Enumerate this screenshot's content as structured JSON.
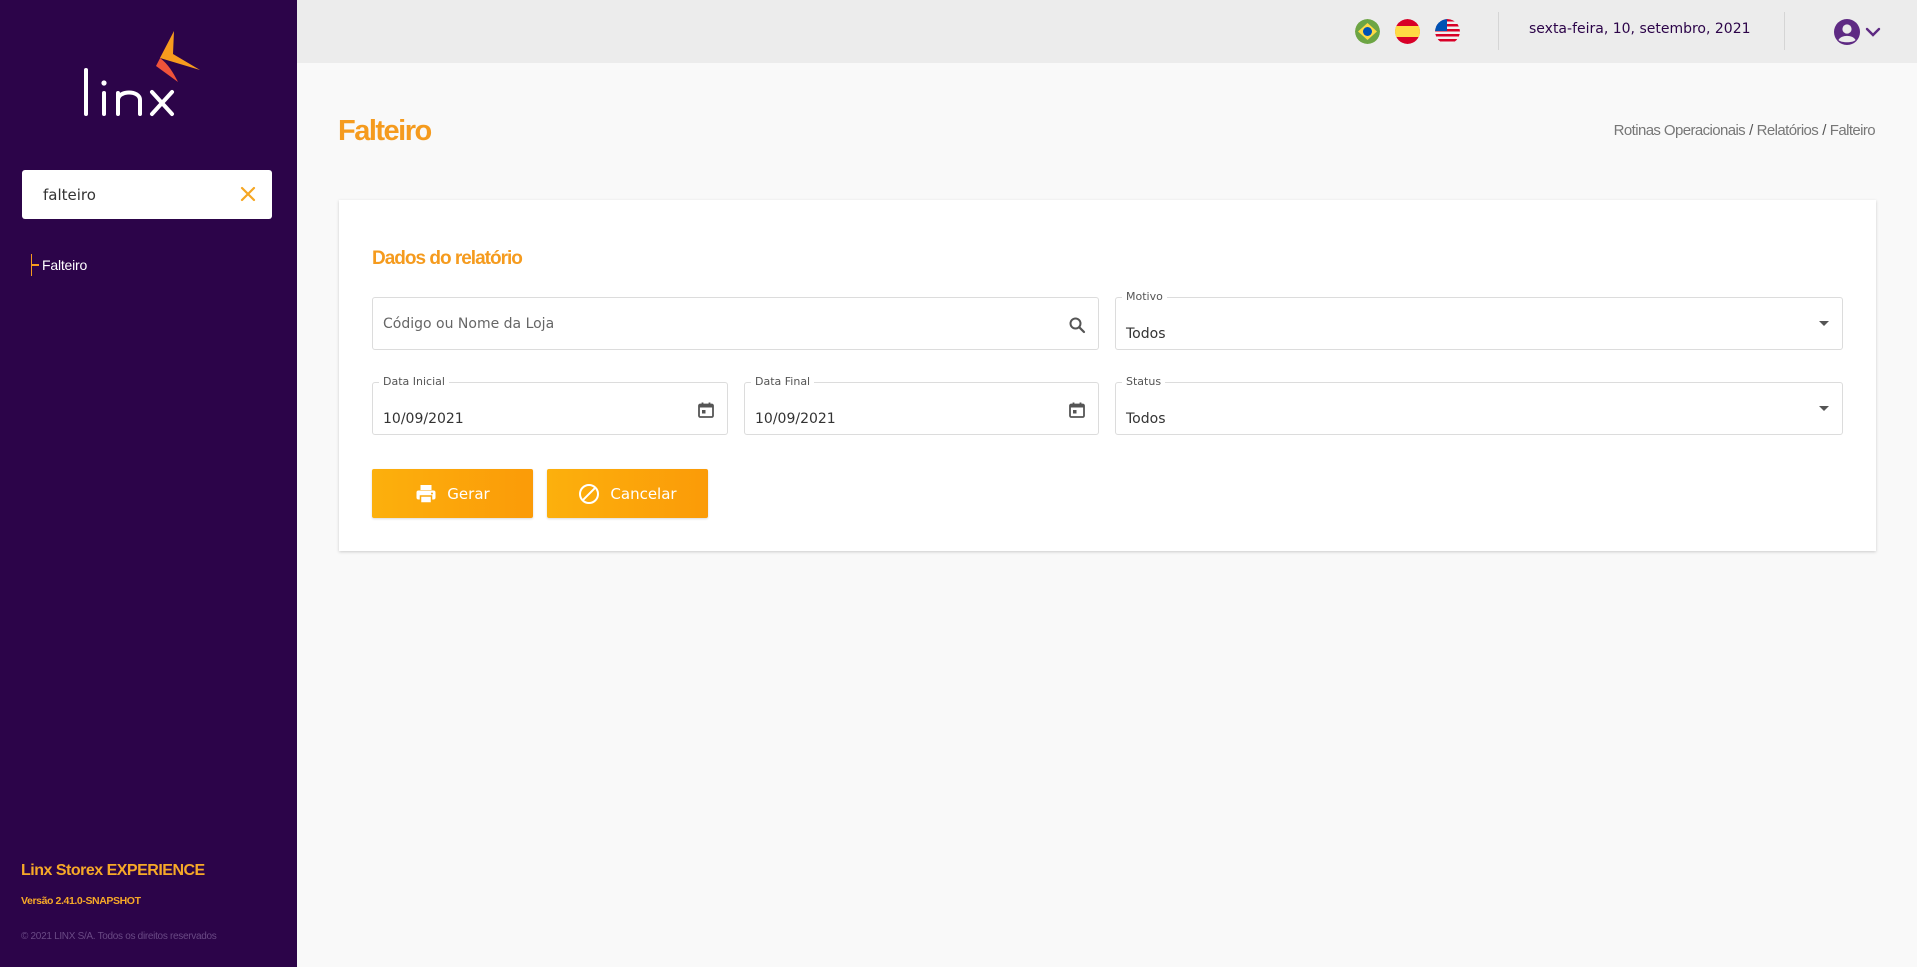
{
  "sidebar": {
    "logo_text": "linx",
    "search_value": "falteiro",
    "menu_items": [
      {
        "label": "Falteiro"
      }
    ],
    "app_name": "Linx Storex EXPERIENCE",
    "version": "Versão 2.41.0-SNAPSHOT",
    "copyright": "© 2021 LINX S/A. Todos os direitos reservados"
  },
  "topbar": {
    "flags": [
      "brazil-flag",
      "spain-flag",
      "usa-flag"
    ],
    "date": "sexta-feira, 10, setembro, 2021"
  },
  "page": {
    "title": "Falteiro",
    "breadcrumb": [
      "Rotinas Operacionais",
      "Relatórios",
      "Falteiro"
    ]
  },
  "form": {
    "section_title": "Dados do relatório",
    "store_placeholder": "Código ou Nome da Loja",
    "motivo": {
      "label": "Motivo",
      "value": "Todos"
    },
    "data_inicial": {
      "label": "Data Inicial",
      "value": "10/09/2021"
    },
    "data_final": {
      "label": "Data Final",
      "value": "10/09/2021"
    },
    "status": {
      "label": "Status",
      "value": "Todos"
    },
    "generate_label": "Gerar",
    "cancel_label": "Cancelar"
  },
  "colors": {
    "sidebar_bg": "#2c0449",
    "accent": "#f59b1e",
    "button": "#fca90b"
  }
}
